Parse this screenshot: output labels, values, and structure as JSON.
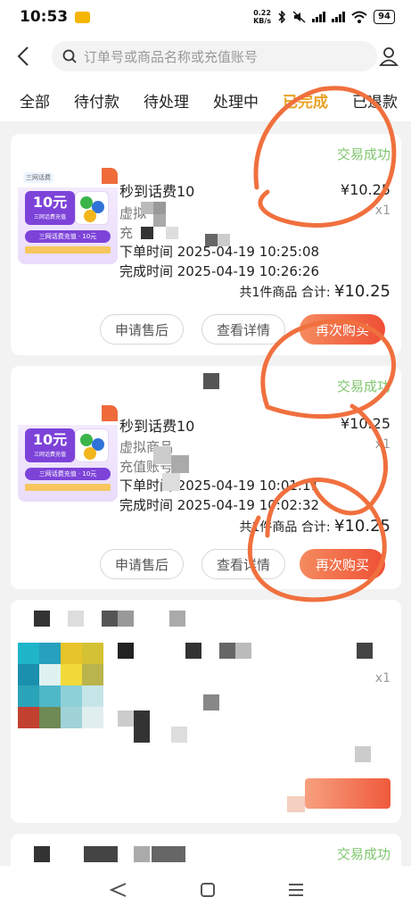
{
  "status_bar": {
    "time": "10:53",
    "net_speed_top": "0.22",
    "net_speed_bottom": "KB/s",
    "battery": "94"
  },
  "search": {
    "placeholder": "订单号或商品名称或充值账号"
  },
  "tabs": [
    {
      "label": "全部",
      "active": false
    },
    {
      "label": "待付款",
      "active": false
    },
    {
      "label": "待处理",
      "active": false
    },
    {
      "label": "处理中",
      "active": false
    },
    {
      "label": "已完成",
      "active": true
    },
    {
      "label": "已退款",
      "active": false
    }
  ],
  "orders": [
    {
      "status": "交易成功",
      "title": "秒到话费10",
      "type": "虚拟",
      "account_label": "充",
      "order_time": "下单时间 2025-04-19 10:25:08",
      "done_time": "完成时间 2025-04-19 10:26:26",
      "price": "¥10.25",
      "qty": "x1",
      "summary_prefix": "共1件商品 合计:",
      "summary_total": "¥10.25",
      "btn_after_sale": "申请售后",
      "btn_details": "查看详情",
      "btn_rebuy": "再次购买",
      "thumb": {
        "denomination": "10元",
        "subtitle": "三网话费充值",
        "banner": "三网话费充值 · 10元",
        "top_tag": "三网话费"
      }
    },
    {
      "status": "交易成功",
      "title": "秒到话费10",
      "type": "虚拟商品",
      "account_label": "充值账号",
      "order_time": "下单时间 2025-04-19 10:01:11",
      "done_time": "完成时间 2025-04-19 10:02:32",
      "price": "¥10.25",
      "qty": "x1",
      "summary_prefix": "共1件商品 合计:",
      "summary_total": "¥10.25",
      "btn_after_sale": "申请售后",
      "btn_details": "查看详情",
      "btn_rebuy": "再次购买",
      "thumb": {
        "denomination": "10元",
        "subtitle": "三网话费充值",
        "banner": "三网话费充值 · 10元"
      }
    },
    {
      "status": "",
      "price": "¥",
      "qty": "x1"
    },
    {
      "status": "交易成功"
    }
  ],
  "colors": {
    "accent": "#e8a326",
    "success": "#7fc66e",
    "primary_btn": "#ef4f35",
    "scribble": "#f0703e"
  }
}
